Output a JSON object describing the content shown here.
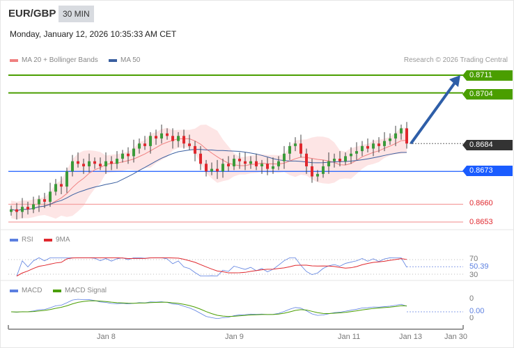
{
  "header": {
    "pair": "EUR/GBP",
    "timeframe": "30 MIN",
    "datetime": "Monday, January 12, 2026 10:35:33 AM CET"
  },
  "legend": {
    "ma20": "MA 20 + Bollinger Bands",
    "ma50": "MA 50",
    "credit": "Research © 2026 Trading Central"
  },
  "colors": {
    "up": "#3a9b3a",
    "down": "#e0282e",
    "ma20": "#f08080",
    "ma50": "#3a5fa0",
    "band": "#fde0e0",
    "resistance": "#4a9e00",
    "current": "#333333",
    "pivot": "#1a5cff",
    "support": "#e0282e"
  },
  "levels": {
    "r2": "0.8711",
    "r1": "0.8704",
    "current": "0.8684",
    "pivot": "0.8673",
    "s1": "0.8660",
    "s2": "0.8653"
  },
  "rsi_panel": {
    "legend_rsi": "RSI",
    "legend_ma": "9MA",
    "upper": "70",
    "lower": "30",
    "value": "50.39"
  },
  "macd_panel": {
    "legend_macd": "MACD",
    "legend_signal": "MACD Signal",
    "top": "0",
    "value": "0.00",
    "bottom": "0"
  },
  "xaxis": {
    "ticks": [
      "Jan 8",
      "Jan 9",
      "Jan 11",
      "Jan 13",
      "Jan 30"
    ]
  },
  "chart_data": {
    "type": "candlestick",
    "title": "EUR/GBP 30 MIN",
    "yrange": [
      0.8653,
      0.8711
    ],
    "closes": [
      0.8658,
      0.8657,
      0.8659,
      0.8658,
      0.866,
      0.8662,
      0.8661,
      0.8665,
      0.8668,
      0.8667,
      0.8673,
      0.8677,
      0.8676,
      0.8675,
      0.8677,
      0.8676,
      0.8675,
      0.8677,
      0.8676,
      0.8678,
      0.868,
      0.8679,
      0.8682,
      0.8684,
      0.8683,
      0.8687,
      0.8686,
      0.8688,
      0.8687,
      0.8685,
      0.8687,
      0.8684,
      0.8683,
      0.868,
      0.8676,
      0.8673,
      0.8674,
      0.8673,
      0.8676,
      0.8675,
      0.8678,
      0.8677,
      0.8676,
      0.8677,
      0.8675,
      0.8676,
      0.8674,
      0.8675,
      0.8677,
      0.868,
      0.8683,
      0.8684,
      0.868,
      0.8675,
      0.8671,
      0.8672,
      0.8675,
      0.8677,
      0.8678,
      0.8677,
      0.8679,
      0.868,
      0.8681,
      0.8683,
      0.8682,
      0.8684,
      0.8683,
      0.8685,
      0.8686,
      0.8688,
      0.869,
      0.8684
    ],
    "forecast_target": 0.8711
  }
}
